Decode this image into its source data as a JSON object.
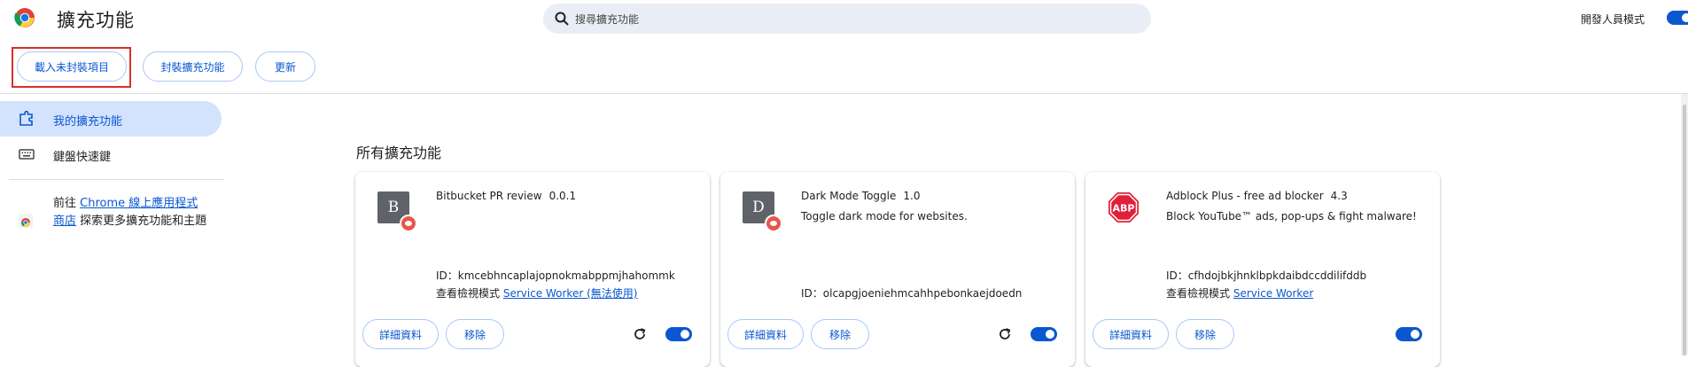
{
  "header": {
    "title": "擴充功能",
    "search_placeholder": "搜尋擴充功能",
    "dev_mode_label": "開發人員模式",
    "dev_mode_on": true,
    "logo": "chrome-logo"
  },
  "toolbar": {
    "load_unpacked": "載入未封裝項目",
    "pack_extension": "封裝擴充功能",
    "update": "更新"
  },
  "sidebar": {
    "items": [
      {
        "label": "我的擴充功能",
        "icon": "extension-icon",
        "active": true
      },
      {
        "label": "鍵盤快速鍵",
        "icon": "keyboard-icon",
        "active": false
      }
    ],
    "store_prefix": "前往 ",
    "store_link": "Chrome 線上應用程式商店",
    "store_suffix": " 探索更多擴充功能和主題"
  },
  "main": {
    "section_title": "所有擴充功能",
    "cards": [
      {
        "icon_letter": "B",
        "name": "Bitbucket PR review",
        "version": "0.0.1",
        "description": "",
        "id_label": "ID：kmcebhncaplajopnokmabppmjhahommk",
        "views_label": "查看檢視模式 ",
        "views_link": "Service Worker (無法使用)",
        "details_label": "詳細資料",
        "remove_label": "移除",
        "has_reload": true,
        "enabled": true
      },
      {
        "icon_letter": "D",
        "name": "Dark Mode Toggle",
        "version": "1.0",
        "description": "Toggle dark mode for websites.",
        "id_label": "ID：olcapgjoeniehmcahhpebonkaejdoedn",
        "views_label": "",
        "views_link": "",
        "details_label": "詳細資料",
        "remove_label": "移除",
        "has_reload": true,
        "enabled": true
      },
      {
        "icon_letter": "ABP",
        "name": "Adblock Plus - free ad blocker",
        "version": "4.3",
        "description": "Block YouTube™ ads, pop-ups & fight malware!",
        "id_label": "ID：cfhdojbkjhnklbpkdaibdccddilifddb",
        "views_label": "查看檢視模式 ",
        "views_link": "Service Worker",
        "details_label": "詳細資料",
        "remove_label": "移除",
        "has_reload": false,
        "enabled": true
      }
    ]
  },
  "colors": {
    "accent": "#0b57d0",
    "active_nav_bg": "#d3e3fd",
    "search_bg": "#e9eef6",
    "highlight_box": "#d93025",
    "abp_red": "#e0203a"
  }
}
